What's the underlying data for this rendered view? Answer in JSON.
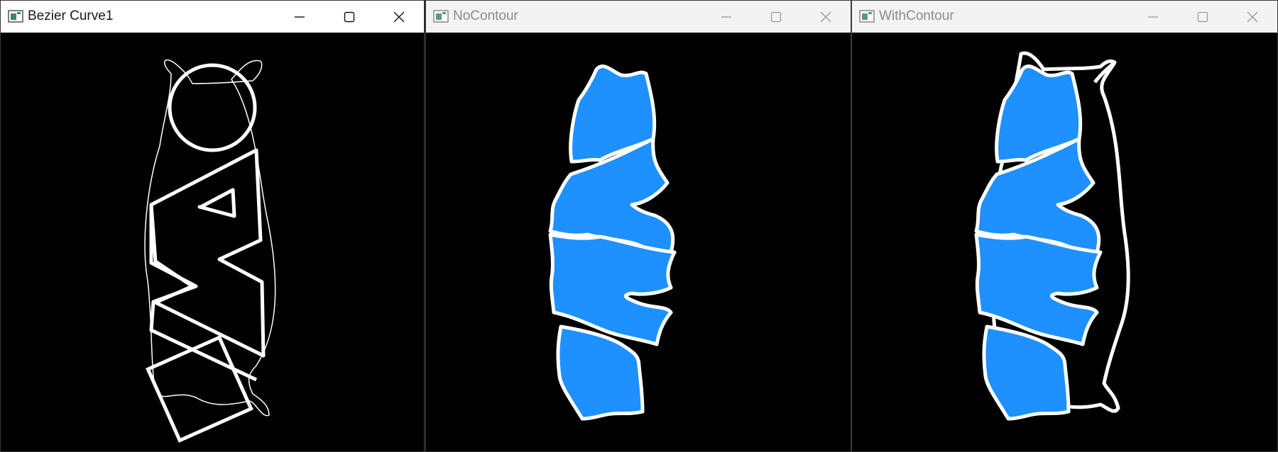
{
  "windows": [
    {
      "title": "Bezier Curve1",
      "active": true
    },
    {
      "title": "NoContour",
      "active": false
    },
    {
      "title": "WithContour",
      "active": false
    }
  ],
  "controls": {
    "minimize": "minimize-icon",
    "maximize": "maximize-icon",
    "close": "close-icon"
  },
  "colors": {
    "fill": "#1e90ff",
    "outline": "#ffffff",
    "background": "#000000"
  }
}
